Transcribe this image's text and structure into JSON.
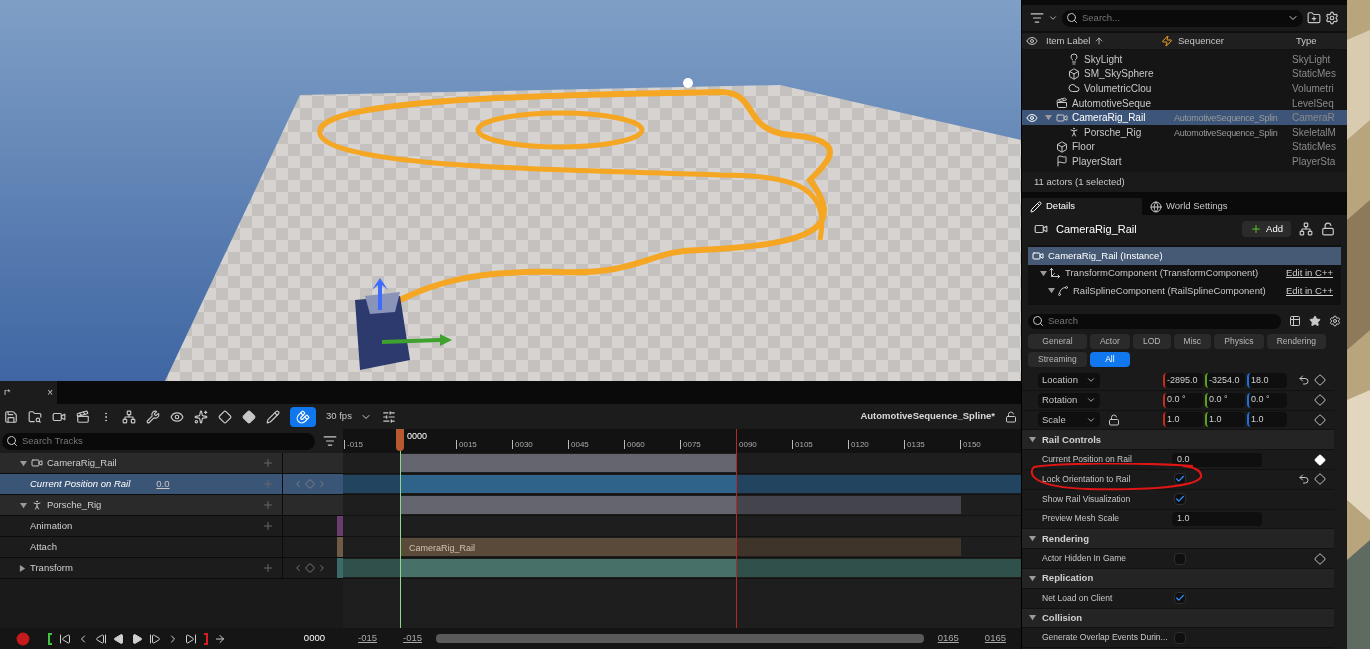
{
  "outliner": {
    "search": {
      "placeholder": "Search..."
    },
    "columns": [
      "Item Label",
      "Sequencer",
      "Type"
    ],
    "rows": [
      {
        "children": [
          {
            "kind": "light",
            "label": "SkyLight",
            "type": "SkyLight",
            "selected": false
          },
          {
            "kind": "mesh",
            "label": "SM_SkySphere",
            "type": "StaticMes",
            "selected": false
          },
          {
            "kind": "cloud",
            "label": "VolumetricClou",
            "type": "Volumetri",
            "selected": false
          }
        ]
      },
      {
        "kind": "sequence",
        "label": "AutomotiveSeque",
        "type": "LevelSeq",
        "selected": false
      },
      {
        "kind": "camera",
        "label": "CameraRig_Rail",
        "sequencer": "AutomotiveSequence_Splin",
        "type": "CameraR",
        "selected": true,
        "expanded": true,
        "children": [
          {
            "kind": "skeleton",
            "label": "Porsche_Rig",
            "sequencer": "AutomotiveSequence_Splin",
            "type": "SkeletalM",
            "selected": false
          }
        ]
      },
      {
        "kind": "mesh",
        "label": "Floor",
        "type": "StaticMes",
        "selected": false
      },
      {
        "kind": "player",
        "label": "PlayerStart",
        "type": "PlayerSta",
        "selected": false
      }
    ],
    "status": "11 actors (1 selected)"
  },
  "details": {
    "tabs": [
      {
        "label": "Details",
        "selected": true
      },
      {
        "label": "World Settings",
        "selected": false
      }
    ],
    "actor": "CameraRig_Rail",
    "add_button": "Add",
    "components": [
      {
        "label": "CameraRig_Rail (Instance)",
        "selected": true,
        "children": [
          {
            "label": "TransformComponent (TransformComponent)",
            "link": "Edit in C++",
            "selected": false,
            "expanded": true,
            "children": [
              {
                "label": "RailSplineComponent (RailSplineComponent)",
                "link": "Edit in C++",
                "selected": false,
                "expanded": true
              }
            ]
          }
        ]
      }
    ],
    "search": {
      "placeholder": "Search"
    },
    "filters": [
      {
        "label": "General",
        "selected": false
      },
      {
        "label": "Actor",
        "selected": false
      },
      {
        "label": "LOD",
        "selected": false
      },
      {
        "label": "Misc",
        "selected": false
      },
      {
        "label": "Physics",
        "selected": false
      },
      {
        "label": "Rendering",
        "selected": false
      },
      {
        "label": "Streaming",
        "selected": false
      },
      {
        "label": "All",
        "selected": true
      }
    ],
    "properties": [
      {
        "kind": "vector",
        "label": "Location",
        "values": [
          "-2895.0",
          "-3254.0",
          "18.0"
        ],
        "reset": true,
        "keyable": true,
        "keyed": false
      },
      {
        "kind": "vector",
        "label": "Rotation",
        "values": [
          "0.0 °",
          "0.0 °",
          "0.0 °"
        ],
        "keyable": true,
        "keyed": false
      },
      {
        "kind": "vector",
        "label": "Scale",
        "values": [
          "1.0",
          "1.0",
          "1.0"
        ],
        "locked": false,
        "keyable": true,
        "keyed": false
      },
      {
        "kind": "section",
        "label": "Rail Controls",
        "expanded": true
      },
      {
        "kind": "number",
        "label": "Current Position on Rail",
        "value": "0.0",
        "keyable": true,
        "keyed": true
      },
      {
        "kind": "check",
        "label": "Lock Orientation to Rail",
        "checked": true,
        "reset": true,
        "keyable": true,
        "keyed": false
      },
      {
        "kind": "check",
        "label": "Show Rail Visualization",
        "checked": true
      },
      {
        "kind": "number",
        "label": "Preview Mesh Scale",
        "value": "1.0"
      },
      {
        "kind": "section",
        "label": "Rendering",
        "expanded": true
      },
      {
        "kind": "check",
        "label": "Actor Hidden In Game",
        "checked": false,
        "keyable": true,
        "keyed": false
      },
      {
        "kind": "section",
        "label": "Replication",
        "expanded": true
      },
      {
        "kind": "check",
        "label": "Net Load on Client",
        "checked": true
      },
      {
        "kind": "section",
        "label": "Collision",
        "expanded": true
      },
      {
        "kind": "check",
        "label": "Generate Overlap Events Durin...",
        "checked": false
      }
    ]
  },
  "annotation": {
    "kind": "ellipse"
  },
  "sequencer": {
    "tab": "r*",
    "close": "×",
    "fps": "30 fps",
    "sequence": "AutomotiveSequence_Spline*",
    "search": {
      "placeholder": "Search Tracks"
    },
    "playhead": "0000",
    "ticks": [
      "-015",
      "0015",
      "0030",
      "0045",
      "0060",
      "0075",
      "0090",
      "0105",
      "0120",
      "0135",
      "0150"
    ],
    "tracks": [
      {
        "label": "CameraRig_Rail",
        "kind": "camera",
        "expanded": true,
        "selected": false
      },
      {
        "label": "Current Position on Rail",
        "kind": "property",
        "value": "0.0",
        "selected": true
      },
      {
        "label": "Porsche_Rig",
        "kind": "skeleton",
        "expanded": true,
        "selected": false
      },
      {
        "label": "Animation",
        "kind": "track",
        "selected": false
      },
      {
        "label": "Attach",
        "kind": "track",
        "section": "CameraRig_Rail",
        "selected": false
      },
      {
        "label": "Transform",
        "kind": "track",
        "expanded": false,
        "selected": false
      }
    ],
    "current_frame": "0000",
    "range": [
      "-015",
      "-015",
      "0165",
      "0165"
    ]
  }
}
